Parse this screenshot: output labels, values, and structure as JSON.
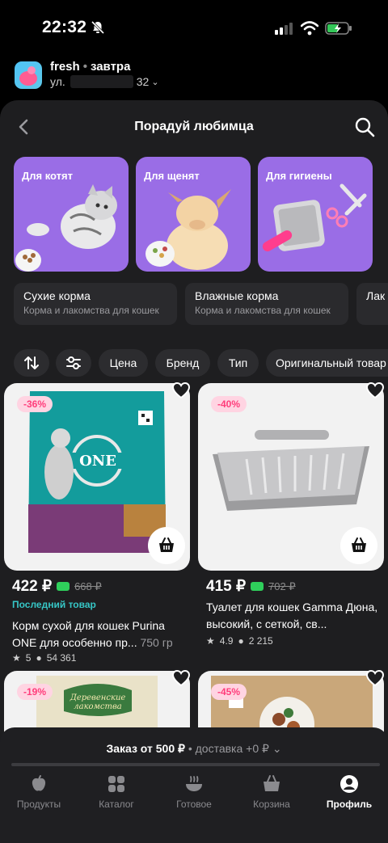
{
  "status_bar": {
    "time": "22:32"
  },
  "header": {
    "store_name": "fresh",
    "delivery_day": "завтра",
    "address_prefix": "ул.",
    "address_house": "32"
  },
  "page": {
    "title": "Порадуй любимца"
  },
  "categories": [
    {
      "label": "Для котят"
    },
    {
      "label": "Для щенят"
    },
    {
      "label": "Для гигиены"
    }
  ],
  "subcategories": [
    {
      "title": "Сухие корма",
      "subtitle": "Корма и лакомства для кошек"
    },
    {
      "title": "Влажные корма",
      "subtitle": "Корма и лакомства для кошек"
    },
    {
      "title": "Лак"
    }
  ],
  "filters": {
    "price": "Цена",
    "brand": "Бренд",
    "type": "Тип",
    "original": "Оригинальный товар"
  },
  "products": [
    {
      "discount": "-36%",
      "price": "422 ₽",
      "old_price": "668 ₽",
      "tag": "Последний товар",
      "name": "Корм сухой для кошек Purina ONE для особенно пр...",
      "weight": "750 гр",
      "rating": "5",
      "reviews": "54 361"
    },
    {
      "discount": "-40%",
      "price": "415 ₽",
      "old_price": "702 ₽",
      "name": "Туалет для кошек Gamma Дюна, высокий, с сеткой, св...",
      "rating": "4.9",
      "reviews": "2 215"
    },
    {
      "discount": "-19%"
    },
    {
      "discount": "-45%"
    }
  ],
  "order_bar": {
    "min_order": "Заказ от 500 ₽",
    "delivery": "доставка +0 ₽"
  },
  "nav": [
    {
      "label": "Продукты",
      "icon": "apple-icon"
    },
    {
      "label": "Каталог",
      "icon": "grid-icon"
    },
    {
      "label": "Готовое",
      "icon": "bowl-icon"
    },
    {
      "label": "Корзина",
      "icon": "basket-icon"
    },
    {
      "label": "Профиль",
      "icon": "profile-icon"
    }
  ],
  "colors": {
    "accent_purple": "#9a6de6",
    "discount_pink": "#ff3d7b",
    "last_item_teal": "#36c6c6",
    "bonus_green": "#2fcf5b"
  }
}
